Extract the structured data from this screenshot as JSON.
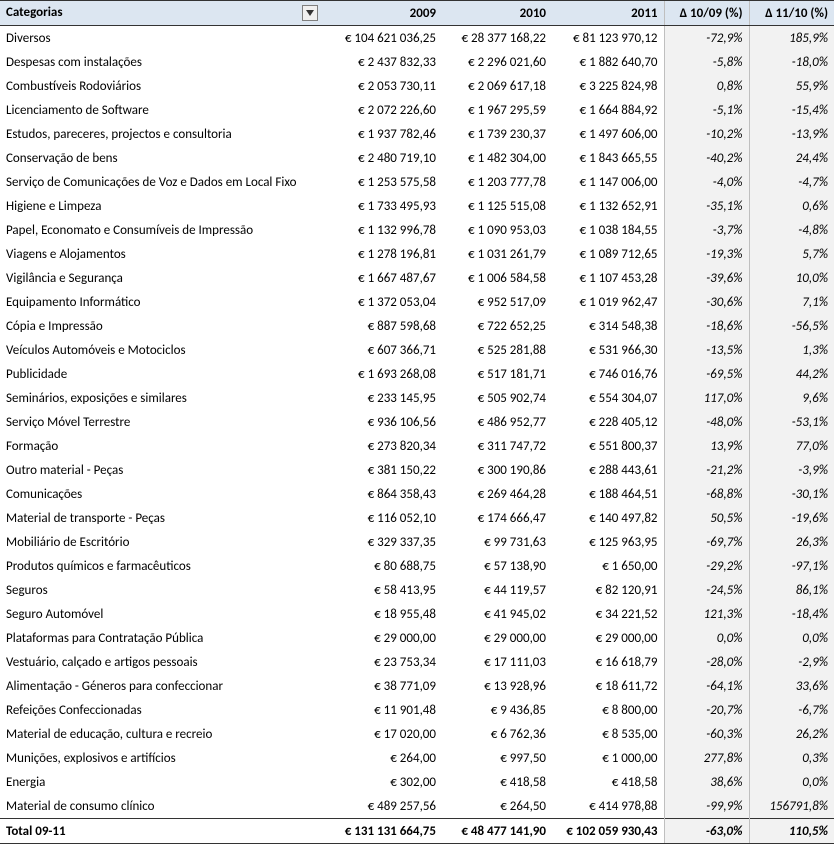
{
  "headers": {
    "cat": "Categorias",
    "y09": "2009",
    "y10": "2010",
    "y11": "2011",
    "d1": "Δ 10/09 (%)",
    "d2": "Δ 11/10 (%)"
  },
  "rows": [
    {
      "cat": "Diversos",
      "y09": "€ 104 621 036,25",
      "y10": "€ 28 377 168,22",
      "y11": "€ 81 123 970,12",
      "d1": "-72,9%",
      "d2": "185,9%"
    },
    {
      "cat": "Despesas com instalações",
      "y09": "€ 2 437 832,33",
      "y10": "€ 2 296 021,60",
      "y11": "€ 1 882 640,70",
      "d1": "-5,8%",
      "d2": "-18,0%"
    },
    {
      "cat": "Combustíveis Rodoviários",
      "y09": "€ 2 053 730,11",
      "y10": "€ 2 069 617,18",
      "y11": "€ 3 225 824,98",
      "d1": "0,8%",
      "d2": "55,9%"
    },
    {
      "cat": "Licenciamento de Software",
      "y09": "€ 2 072 226,60",
      "y10": "€ 1 967 295,59",
      "y11": "€ 1 664 884,92",
      "d1": "-5,1%",
      "d2": "-15,4%"
    },
    {
      "cat": "Estudos, pareceres, projectos e consultoria",
      "y09": "€ 1 937 782,46",
      "y10": "€ 1 739 230,37",
      "y11": "€ 1 497 606,00",
      "d1": "-10,2%",
      "d2": "-13,9%"
    },
    {
      "cat": "Conservação de bens",
      "y09": "€ 2 480 719,10",
      "y10": "€ 1 482 304,00",
      "y11": "€ 1 843 665,55",
      "d1": "-40,2%",
      "d2": "24,4%"
    },
    {
      "cat": "Serviço de Comunicações de Voz e Dados em Local Fixo",
      "y09": "€ 1 253 575,58",
      "y10": "€ 1 203 777,78",
      "y11": "€ 1 147 006,00",
      "d1": "-4,0%",
      "d2": "-4,7%"
    },
    {
      "cat": "Higiene e Limpeza",
      "y09": "€ 1 733 495,93",
      "y10": "€ 1 125 515,08",
      "y11": "€ 1 132 652,91",
      "d1": "-35,1%",
      "d2": "0,6%"
    },
    {
      "cat": "Papel, Economato e Consumíveis de Impressão",
      "y09": "€ 1 132 996,78",
      "y10": "€ 1 090 953,03",
      "y11": "€ 1 038 184,55",
      "d1": "-3,7%",
      "d2": "-4,8%"
    },
    {
      "cat": "Viagens e Alojamentos",
      "y09": "€ 1 278 196,81",
      "y10": "€ 1 031 261,79",
      "y11": "€ 1 089 712,65",
      "d1": "-19,3%",
      "d2": "5,7%"
    },
    {
      "cat": "Vigilância e Segurança",
      "y09": "€ 1 667 487,67",
      "y10": "€ 1 006 584,58",
      "y11": "€ 1 107 453,28",
      "d1": "-39,6%",
      "d2": "10,0%"
    },
    {
      "cat": "Equipamento Informático",
      "y09": "€ 1 372 053,04",
      "y10": "€  952 517,09",
      "y11": "€ 1 019 962,47",
      "d1": "-30,6%",
      "d2": "7,1%"
    },
    {
      "cat": "Cópia e Impressão",
      "y09": "€  887 598,68",
      "y10": "€  722 652,25",
      "y11": "€  314 548,38",
      "d1": "-18,6%",
      "d2": "-56,5%"
    },
    {
      "cat": "Veículos Automóveis e Motociclos",
      "y09": "€  607 366,71",
      "y10": "€  525 281,88",
      "y11": "€  531 966,30",
      "d1": "-13,5%",
      "d2": "1,3%"
    },
    {
      "cat": "Publicidade",
      "y09": "€ 1 693 268,08",
      "y10": "€  517 181,71",
      "y11": "€  746 016,76",
      "d1": "-69,5%",
      "d2": "44,2%"
    },
    {
      "cat": "Seminários, exposições e similares",
      "y09": "€  233 145,95",
      "y10": "€  505 902,74",
      "y11": "€  554 304,07",
      "d1": "117,0%",
      "d2": "9,6%"
    },
    {
      "cat": "Serviço Móvel Terrestre",
      "y09": "€  936 106,56",
      "y10": "€  486 952,77",
      "y11": "€  228 405,12",
      "d1": "-48,0%",
      "d2": "-53,1%"
    },
    {
      "cat": "Formação",
      "y09": "€  273 820,34",
      "y10": "€  311 747,72",
      "y11": "€  551 800,37",
      "d1": "13,9%",
      "d2": "77,0%"
    },
    {
      "cat": "Outro material - Peças",
      "y09": "€  381 150,22",
      "y10": "€  300 190,86",
      "y11": "€  288 443,61",
      "d1": "-21,2%",
      "d2": "-3,9%"
    },
    {
      "cat": "Comunicações",
      "y09": "€  864 358,43",
      "y10": "€  269 464,28",
      "y11": "€  188 464,51",
      "d1": "-68,8%",
      "d2": "-30,1%"
    },
    {
      "cat": "Material de transporte - Peças",
      "y09": "€  116 052,10",
      "y10": "€  174 666,47",
      "y11": "€  140 497,82",
      "d1": "50,5%",
      "d2": "-19,6%"
    },
    {
      "cat": "Mobiliário de Escritório",
      "y09": "€  329 337,35",
      "y10": "€  99 731,63",
      "y11": "€  125 963,95",
      "d1": "-69,7%",
      "d2": "26,3%"
    },
    {
      "cat": "Produtos químicos e farmacêuticos",
      "y09": "€  80 688,75",
      "y10": "€  57 138,90",
      "y11": "€  1 650,00",
      "d1": "-29,2%",
      "d2": "-97,1%"
    },
    {
      "cat": "Seguros",
      "y09": "€  58 413,95",
      "y10": "€  44 119,57",
      "y11": "€  82 120,91",
      "d1": "-24,5%",
      "d2": "86,1%"
    },
    {
      "cat": "Seguro Automóvel",
      "y09": "€  18 955,48",
      "y10": "€  41 945,02",
      "y11": "€  34 221,52",
      "d1": "121,3%",
      "d2": "-18,4%"
    },
    {
      "cat": "Plataformas para Contratação Pública",
      "y09": "€  29 000,00",
      "y10": "€  29 000,00",
      "y11": "€  29 000,00",
      "d1": "0,0%",
      "d2": "0,0%"
    },
    {
      "cat": "Vestuário, calçado e artigos pessoais",
      "y09": "€  23 753,34",
      "y10": "€  17 111,03",
      "y11": "€  16 618,79",
      "d1": "-28,0%",
      "d2": "-2,9%"
    },
    {
      "cat": "Alimentação - Géneros para confeccionar",
      "y09": "€  38 771,09",
      "y10": "€  13 928,96",
      "y11": "€  18 611,72",
      "d1": "-64,1%",
      "d2": "33,6%"
    },
    {
      "cat": "Refeições Confeccionadas",
      "y09": "€  11 901,48",
      "y10": "€  9 436,85",
      "y11": "€  8 800,00",
      "d1": "-20,7%",
      "d2": "-6,7%"
    },
    {
      "cat": "Material de educação, cultura e recreio",
      "y09": "€  17 020,00",
      "y10": "€  6 762,36",
      "y11": "€  8 535,00",
      "d1": "-60,3%",
      "d2": "26,2%"
    },
    {
      "cat": "Munições, explosivos e artifícios",
      "y09": "€   264,00",
      "y10": "€   997,50",
      "y11": "€  1 000,00",
      "d1": "277,8%",
      "d2": "0,3%"
    },
    {
      "cat": "Energia",
      "y09": "€   302,00",
      "y10": "€   418,58",
      "y11": "€   418,58",
      "d1": "38,6%",
      "d2": "0,0%"
    },
    {
      "cat": "Material de consumo clínico",
      "y09": "€  489 257,56",
      "y10": "€   264,50",
      "y11": "€  414 978,88",
      "d1": "-99,9%",
      "d2": "156791,8%"
    }
  ],
  "total": {
    "cat": "Total 09-11",
    "y09": "€ 131 131 664,75",
    "y10": "€ 48 477 141,90",
    "y11": "€ 102 059 930,43",
    "d1": "-63,0%",
    "d2": "110,5%"
  }
}
